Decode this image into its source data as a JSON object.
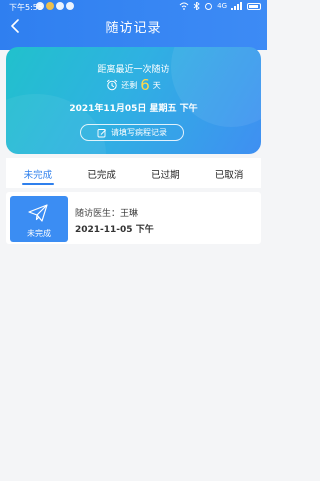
{
  "status_bar": {
    "time": "下午5:55",
    "right_text": "4G"
  },
  "nav": {
    "title": "随访记录"
  },
  "hero": {
    "caption": "距离最近一次随访",
    "remain_prefix": "还剩",
    "remain_days": "6",
    "remain_suffix": "天",
    "date": "2021年11月05日 星期五 下午",
    "record_button_label": "请填写病程记录"
  },
  "tabs": [
    {
      "label": "未完成",
      "active": true
    },
    {
      "label": "已完成",
      "active": false
    },
    {
      "label": "已过期",
      "active": false
    },
    {
      "label": "已取消",
      "active": false
    }
  ],
  "visits": [
    {
      "badge_label": "未完成",
      "doctor_prefix": "随访医生：",
      "doctor_name": "王琳",
      "date": "2021-11-05 下午"
    }
  ],
  "colors": {
    "primary": "#2f80ed",
    "highlight": "#ffd84a",
    "background": "#f4f5f7"
  }
}
